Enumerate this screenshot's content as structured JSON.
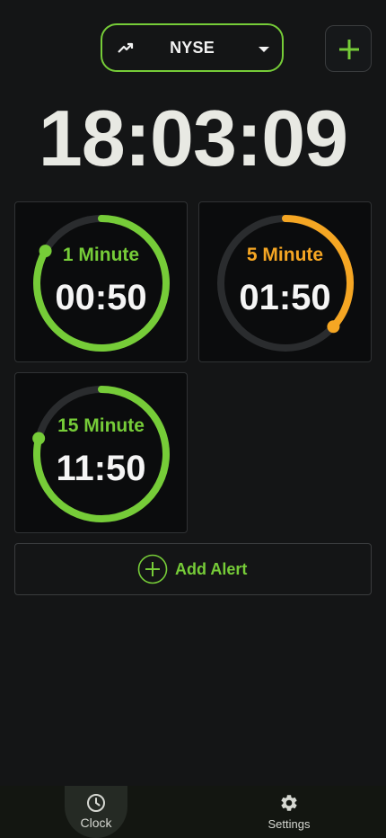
{
  "header": {
    "market": "NYSE",
    "market_icon": "trending-up-icon",
    "add_icon": "plus-icon"
  },
  "clock": {
    "time": "18:03:09"
  },
  "timers": [
    {
      "name": "1 Minute",
      "remaining": "00:50",
      "color": "#76cc38",
      "progress": 0.833
    },
    {
      "name": "5 Minute",
      "remaining": "01:50",
      "color": "#f5a623",
      "progress": 0.367
    },
    {
      "name": "15 Minute",
      "remaining": "11:50",
      "color": "#76cc38",
      "progress": 0.789
    }
  ],
  "add_alert": {
    "label": "Add Alert",
    "icon": "plus-circle-icon"
  },
  "nav": {
    "clock_label": "Clock",
    "settings_label": "Settings"
  },
  "colors": {
    "accent": "#76cc38",
    "warning": "#f5a623",
    "track": "#2a2c2e"
  }
}
